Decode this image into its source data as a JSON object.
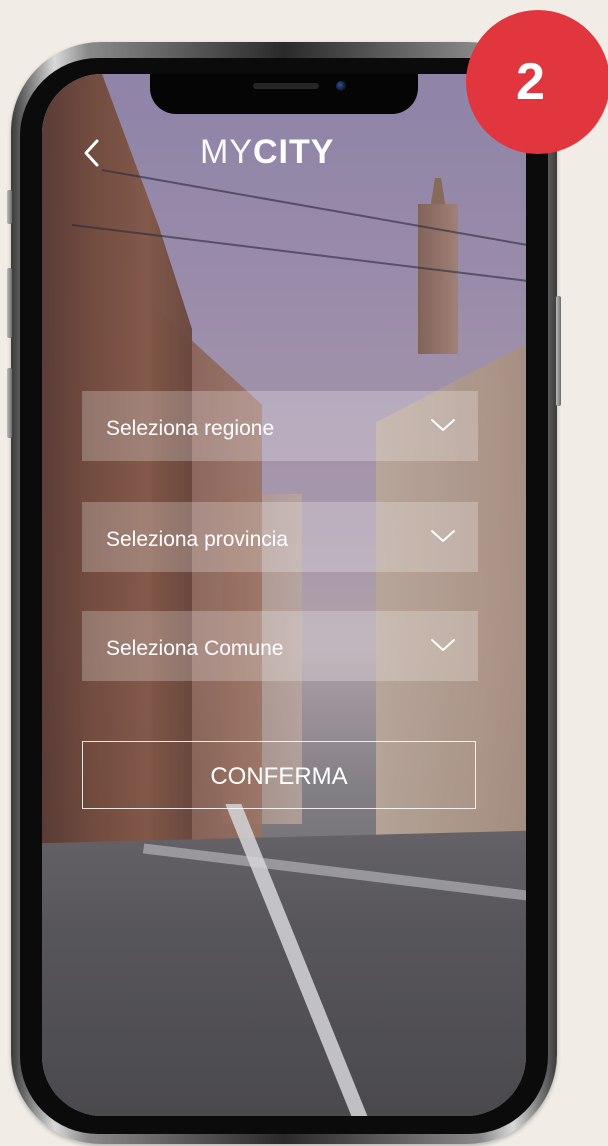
{
  "app": {
    "brand_thin": "MY",
    "brand_bold": "CITY"
  },
  "header": {
    "back_icon": "chevron-left-icon"
  },
  "form": {
    "region_select": {
      "label": "Seleziona regione",
      "icon": "chevron-down-icon"
    },
    "province_select": {
      "label": "Seleziona provincia",
      "icon": "chevron-down-icon"
    },
    "comune_select": {
      "label": "Seleziona Comune",
      "icon": "chevron-down-icon"
    },
    "confirm_label": "CONFERMA"
  },
  "step_badge": {
    "number": "2",
    "color": "#e2363f"
  },
  "colors": {
    "page_background": "#f1ede6",
    "text": "#ffffff"
  }
}
